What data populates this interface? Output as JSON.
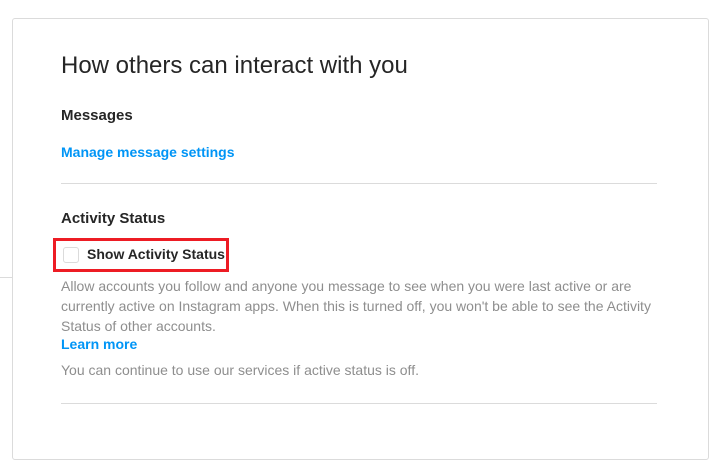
{
  "title": "How others can interact with you",
  "messages": {
    "heading": "Messages",
    "link": "Manage message settings"
  },
  "activity_status": {
    "heading": "Activity Status",
    "checkbox_label": "Show Activity Status",
    "checked": false,
    "description": "Allow accounts you follow and anyone you message to see when you were last active or are currently active on Instagram apps. When this is turned off, you won't be able to see the Activity Status of other accounts.",
    "learn_more": "Learn more",
    "note": "You can continue to use our services if active status is off."
  },
  "colors": {
    "link": "#0095f6",
    "highlight": "#ed1c24",
    "muted": "#8e8e8e"
  }
}
